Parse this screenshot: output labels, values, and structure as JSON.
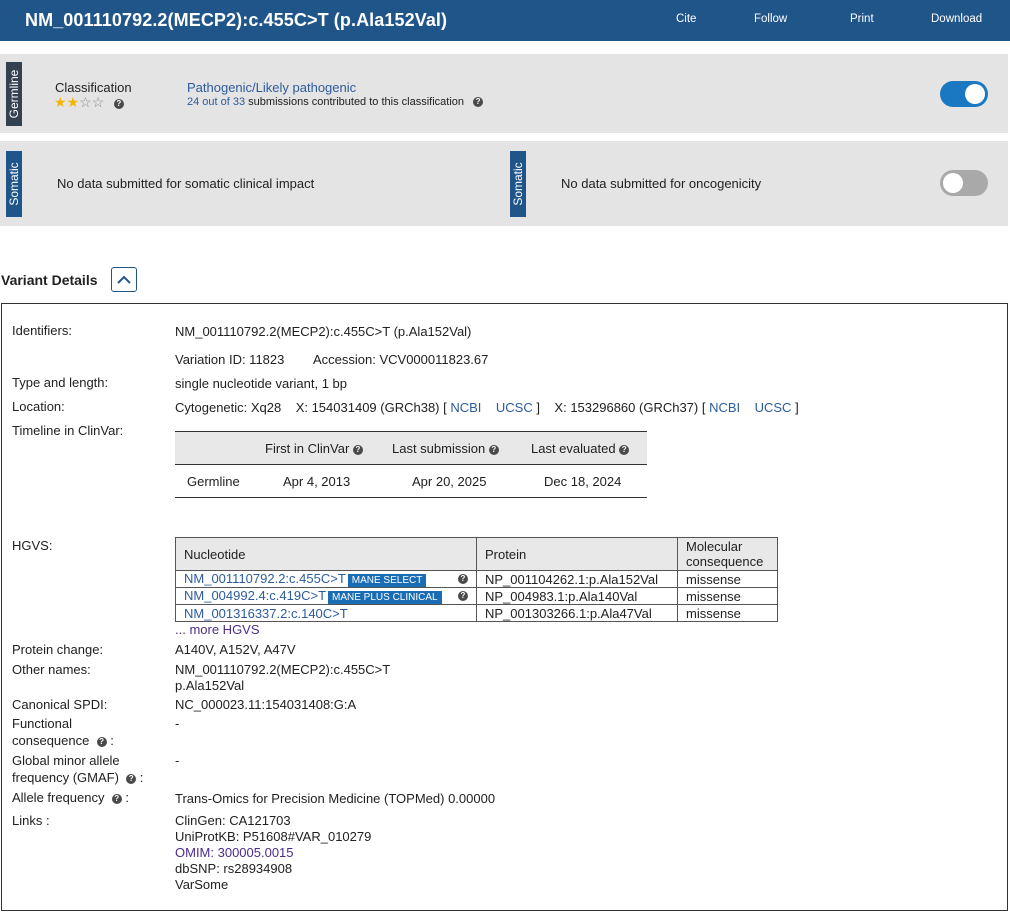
{
  "header": {
    "title": "NM_001110792.2(MECP2):c.455C>T (p.Ala152Val)",
    "actions": {
      "cite": "Cite",
      "follow": "Follow",
      "print": "Print",
      "download": "Download"
    }
  },
  "germline": {
    "tab": "Germline",
    "classification_label": "Classification",
    "stars_filled": 2,
    "stars_total": 4,
    "classification": "Pathogenic/Likely pathogenic",
    "submissions_link": "24 out of 33",
    "submissions_text": "submissions contributed to this classification",
    "toggle_on": true
  },
  "somatic": {
    "tab1": "Somatic",
    "impact_text": "No data submitted for somatic clinical impact",
    "tab2": "Somatic",
    "oncogenicity_text": "No data submitted for oncogenicity",
    "toggle_on": false
  },
  "details": {
    "section_title": "Variant Details",
    "identifiers_label": "Identifiers:",
    "identifiers_value": "NM_001110792.2(MECP2):c.455C>T (p.Ala152Val)",
    "variation_id": "Variation ID: 11823",
    "accession": "Accession: VCV000011823.67",
    "type_label": "Type and length:",
    "type_value": "single nucleotide variant, 1 bp",
    "location_label": "Location:",
    "location": {
      "cytogenetic": "Cytogenetic: Xq28",
      "grch38": "X: 154031409 (GRCh38) [",
      "ncbi": "NCBI",
      "ucsc": "UCSC",
      "close": "]",
      "grch37": "X: 153296860 (GRCh37) [",
      "ncbi2": "NCBI",
      "ucsc2": "UCSC",
      "close2": "]"
    },
    "timeline_label": "Timeline in ClinVar:",
    "timeline": {
      "headers": [
        "First in ClinVar",
        "Last submission",
        "Last evaluated"
      ],
      "row_label": "Germline",
      "values": [
        "Apr 4, 2013",
        "Apr 20, 2025",
        "Dec 18, 2024"
      ]
    },
    "hgvs_label": "HGVS:",
    "hgvs": {
      "headers": [
        "Nucleotide",
        "Protein",
        "Molecular consequence"
      ],
      "rows": [
        {
          "nucleotide": "NM_001110792.2:c.455C>T",
          "badge": "MANE SELECT",
          "protein": "NP_001104262.1:p.Ala152Val",
          "consequence": "missense"
        },
        {
          "nucleotide": "NM_004992.4:c.419C>T",
          "badge": "MANE PLUS CLINICAL",
          "protein": "NP_004983.1:p.Ala140Val",
          "consequence": "missense"
        },
        {
          "nucleotide": "NM_001316337.2:c.140C>T",
          "badge": "",
          "protein": "NP_001303266.1:p.Ala47Val",
          "consequence": "missense"
        }
      ],
      "more": "... more HGVS"
    },
    "protein_change_label": "Protein change:",
    "protein_change": "A140V, A152V, A47V",
    "other_names_label": "Other names:",
    "other_names": [
      "NM_001110792.2(MECP2):c.455C>T",
      "p.Ala152Val"
    ],
    "spdi_label": "Canonical SPDI:",
    "spdi": "NC_000023.11:154031408:G:A",
    "functional_label_1": "Functional",
    "functional_label_2": "consequence",
    "functional_value": "-",
    "gmaf_label_1": "Global minor allele",
    "gmaf_label_2": "frequency (GMAF)",
    "gmaf_value": "-",
    "allele_label": "Allele frequency",
    "allele_value": "Trans-Omics for Precision Medicine (TOPMed) 0.00000",
    "links_label": "Links :",
    "links": [
      "ClinGen: CA121703",
      "UniProtKB: P51608#VAR_010279",
      "OMIM: 300005.0015",
      "dbSNP: rs28934908",
      "VarSome"
    ]
  }
}
